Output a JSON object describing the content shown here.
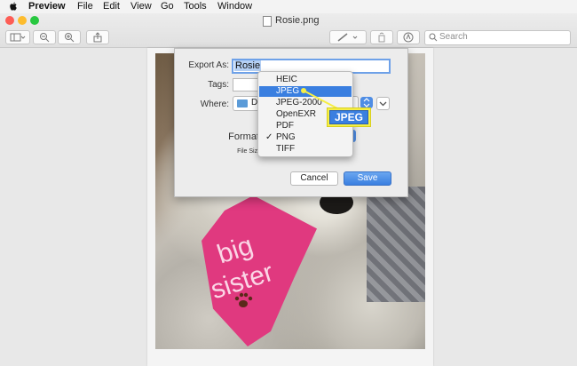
{
  "menubar": {
    "app_name": "Preview",
    "items": [
      "File",
      "Edit",
      "View",
      "Go",
      "Tools",
      "Window"
    ]
  },
  "window": {
    "title": "Rosie.png",
    "traffic_lights": {
      "close": "#fd5d55",
      "minimize": "#fdbc2e",
      "zoom": "#28c840"
    }
  },
  "toolbar": {
    "search_placeholder": "Search",
    "icons": [
      "sidebar-icon",
      "zoom-out-icon",
      "zoom-in-icon",
      "share-icon",
      "markup-pen-icon",
      "rotate-icon",
      "annotate-icon",
      "search-icon"
    ]
  },
  "dialog": {
    "export_as_label": "Export As:",
    "export_as_value": "Rosie",
    "tags_label": "Tags:",
    "where_label": "Where:",
    "where_value": "De",
    "format_label": "Format",
    "file_size_label": "File Size",
    "cancel_label": "Cancel",
    "save_label": "Save"
  },
  "format_menu": {
    "options": [
      "HEIC",
      "JPEG",
      "JPEG-2000",
      "OpenEXR",
      "PDF",
      "PNG",
      "TIFF"
    ],
    "highlighted": "JPEG",
    "checked": "PNG",
    "checkmark": "✓"
  },
  "callout": {
    "label": "JPEG",
    "border_color": "#f6ef45",
    "fill_color": "#3a7fe0"
  },
  "photo": {
    "bandana_text_line1": "big",
    "bandana_text_line2": "sister"
  },
  "colors": {
    "accent": "#3a7fe0",
    "selection": "#b4cff3"
  }
}
